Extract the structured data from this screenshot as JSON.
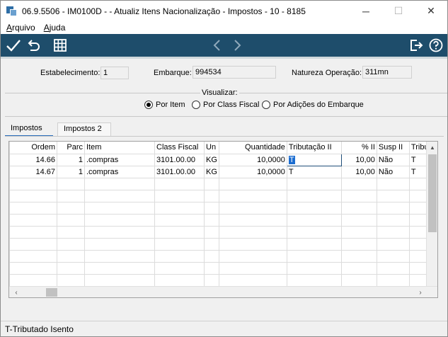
{
  "window": {
    "title": "06.9.5506 - IM0100D -  - Atualiz Itens Nacionalização - Impostos - 10 - 8185",
    "minimize": "─",
    "maximize": "☐",
    "close": "✕"
  },
  "menu": {
    "arquivo_first": "A",
    "arquivo_rest": "rquivo",
    "ajuda_first": "A",
    "ajuda_rest": "juda"
  },
  "toolbar": {
    "icons": [
      "check-icon",
      "undo-icon",
      "grid-icon",
      "chevron-left-icon",
      "chevron-right-icon",
      "exit-icon",
      "help-icon"
    ]
  },
  "fields": {
    "estabelecimento_label": "Estabelecimento:",
    "estabelecimento_value": "1",
    "embarque_label": "Embarque:",
    "embarque_value": "994534",
    "natureza_label": "Natureza Operação:",
    "natureza_value": "311mn"
  },
  "visualizar": {
    "label": "Visualizar:",
    "options": [
      "Por Item",
      "Por Class Fiscal",
      "Por Adições do Embarque"
    ],
    "selected": "Por Item"
  },
  "tabs": [
    "Impostos",
    "Impostos 2"
  ],
  "grid": {
    "columns": [
      "Ordem",
      "Parc",
      "Item",
      "Class Fiscal",
      "Un",
      "Quantidade",
      "Tributação II",
      "% II",
      "Susp II",
      "Tribu"
    ],
    "rows": [
      [
        "14.66",
        "1",
        ".compras",
        "3101.00.00",
        "KG",
        "10,0000",
        "T",
        "10,00",
        "Não",
        "T"
      ],
      [
        "14.67",
        "1",
        ".compras",
        "3101.00.00",
        "KG",
        "10,0000",
        "T",
        "10,00",
        "Não",
        "T"
      ]
    ]
  },
  "status": {
    "text": "T-Tributado Isento"
  },
  "colors": {
    "toolbar": "#1e4d6b",
    "active_tab": "#2a6ebb"
  }
}
